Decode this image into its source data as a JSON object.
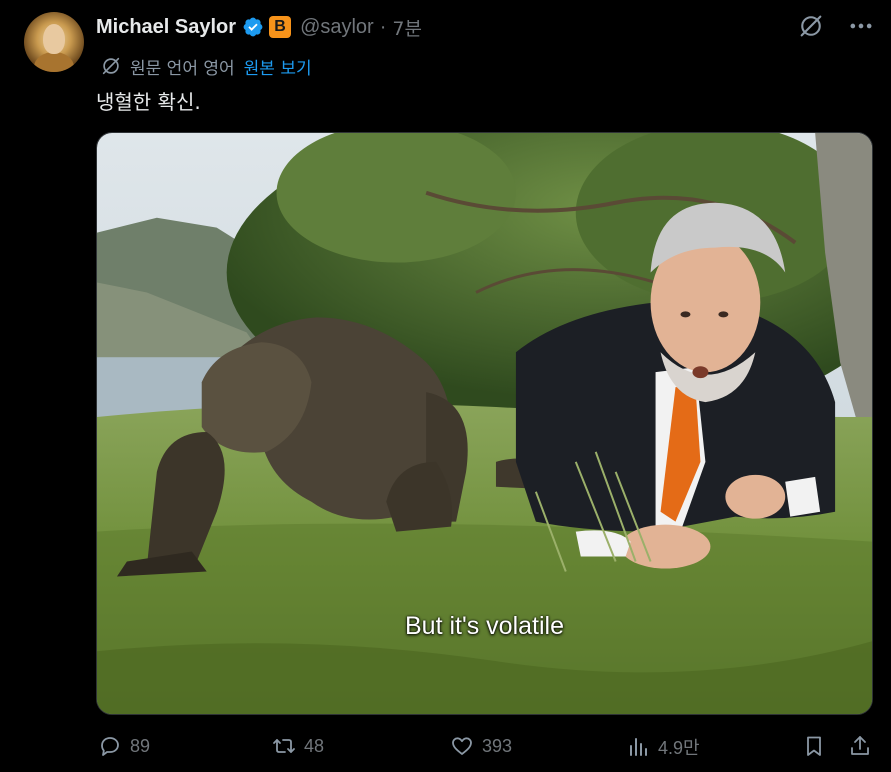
{
  "author": {
    "display_name": "Michael Saylor",
    "handle": "@saylor",
    "separator": "·",
    "time": "7분",
    "badge_glyph": "B",
    "badge_color": "#f7931a",
    "verified_color": "#1d9bf0"
  },
  "translation": {
    "label": "원문 언어 영어",
    "action": "원본 보기"
  },
  "tweet": {
    "text": "냉혈한 확신."
  },
  "media": {
    "subtitle": "But it's volatile"
  },
  "actions": {
    "replies": "89",
    "reposts": "48",
    "likes": "393",
    "views": "4.9만"
  },
  "icons": [
    "grok-icon",
    "more-icon",
    "translate-icon",
    "reply-icon",
    "repost-icon",
    "like-icon",
    "views-icon",
    "bookmark-icon",
    "share-icon"
  ],
  "colors": {
    "background": "#000000",
    "text": "#e7e9ea",
    "muted": "#71767b",
    "link": "#1d9bf0"
  }
}
